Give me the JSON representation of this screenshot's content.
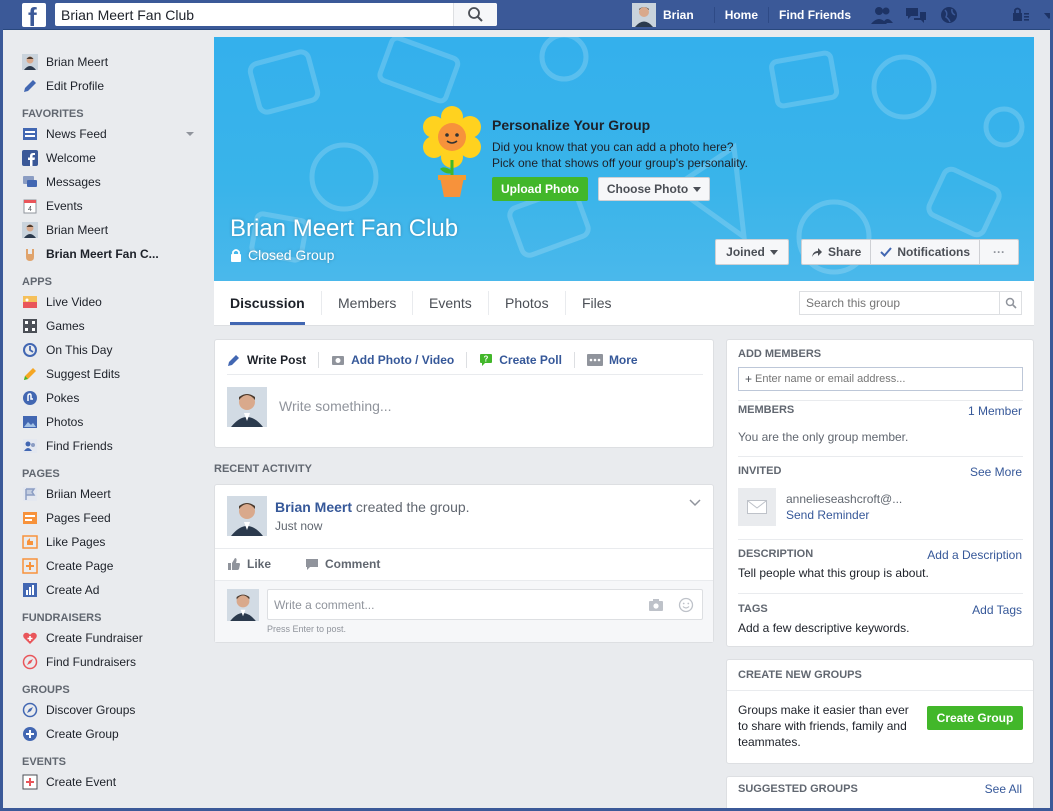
{
  "topbar": {
    "logo": "f",
    "search_value": "Brian Meert Fan Club",
    "user_name": "Brian",
    "links": [
      "Home",
      "Find Friends"
    ],
    "icons": [
      "friend-requests-icon",
      "messages-icon",
      "notifications-globe-icon",
      "privacy-lock-icon",
      "account-menu-icon"
    ]
  },
  "sidebar": {
    "profile": [
      {
        "label": "Brian Meert",
        "icon": "avatar"
      },
      {
        "label": "Edit Profile",
        "icon": "pencil-icon"
      }
    ],
    "sections": [
      {
        "heading": "FAVORITES",
        "items": [
          {
            "label": "News Feed",
            "icon": "news-feed-icon"
          },
          {
            "label": "Welcome",
            "icon": "facebook-icon"
          },
          {
            "label": "Messages",
            "icon": "messages-icon"
          },
          {
            "label": "Events",
            "icon": "calendar-icon"
          },
          {
            "label": "Brian Meert",
            "icon": "avatar"
          },
          {
            "label": "Brian Meert Fan C...",
            "icon": "rock-hand-icon"
          }
        ]
      },
      {
        "heading": "APPS",
        "items": [
          {
            "label": "Live Video",
            "icon": "live-video-icon"
          },
          {
            "label": "Games",
            "icon": "games-icon"
          },
          {
            "label": "On This Day",
            "icon": "clock-icon"
          },
          {
            "label": "Suggest Edits",
            "icon": "suggest-edits-icon"
          },
          {
            "label": "Pokes",
            "icon": "poke-icon"
          },
          {
            "label": "Photos",
            "icon": "photos-icon"
          },
          {
            "label": "Find Friends",
            "icon": "find-friends-icon"
          }
        ]
      },
      {
        "heading": "PAGES",
        "items": [
          {
            "label": "Briian Meert",
            "icon": "flag-icon"
          },
          {
            "label": "Pages Feed",
            "icon": "pages-feed-icon"
          },
          {
            "label": "Like Pages",
            "icon": "like-pages-icon"
          },
          {
            "label": "Create Page",
            "icon": "create-page-icon"
          },
          {
            "label": "Create Ad",
            "icon": "create-ad-icon"
          }
        ]
      },
      {
        "heading": "FUNDRAISERS",
        "items": [
          {
            "label": "Create Fundraiser",
            "icon": "heart-plus-icon"
          },
          {
            "label": "Find Fundraisers",
            "icon": "compass-icon"
          }
        ]
      },
      {
        "heading": "GROUPS",
        "items": [
          {
            "label": "Discover Groups",
            "icon": "compass-blue-icon"
          },
          {
            "label": "Create Group",
            "icon": "plus-circle-icon"
          }
        ]
      },
      {
        "heading": "EVENTS",
        "items": [
          {
            "label": "Create Event",
            "icon": "create-event-icon"
          }
        ]
      }
    ]
  },
  "cover": {
    "promo_title": "Personalize Your Group",
    "promo_line1": "Did you know that you can add a photo here?",
    "promo_line2": "Pick one that shows off your group's personality.",
    "upload_label": "Upload Photo",
    "choose_label": "Choose Photo",
    "group_name": "Brian Meert Fan Club",
    "privacy": "Closed Group",
    "joined_label": "Joined",
    "share_label": "Share",
    "notifications_label": "Notifications",
    "more_label": "···"
  },
  "tabs": {
    "items": [
      "Discussion",
      "Members",
      "Events",
      "Photos",
      "Files"
    ],
    "active": "Discussion",
    "search_placeholder": "Search this group"
  },
  "composer": {
    "tabs": [
      "Write Post",
      "Add Photo / Video",
      "Create Poll",
      "More"
    ],
    "placeholder": "Write something..."
  },
  "activity": {
    "heading": "RECENT ACTIVITY",
    "author": "Brian Meert",
    "action": "created the group.",
    "time": "Just now",
    "like_label": "Like",
    "comment_label": "Comment",
    "comment_placeholder": "Write a comment...",
    "comment_hint": "Press Enter to post."
  },
  "right": {
    "add_members_heading": "ADD MEMBERS",
    "add_members_placeholder": "Enter name or email address...",
    "members_heading": "MEMBERS",
    "members_count": "1 Member",
    "members_text": "You are the only group member.",
    "invited_heading": "INVITED",
    "invited_see_more": "See More",
    "invited_email": "annelieseashcroft@...",
    "send_reminder": "Send Reminder",
    "description_heading": "DESCRIPTION",
    "add_description": "Add a Description",
    "description_text": "Tell people what this group is about.",
    "tags_heading": "TAGS",
    "add_tags": "Add Tags",
    "tags_text": "Add a few descriptive keywords.",
    "create_groups_heading": "CREATE NEW GROUPS",
    "create_groups_text": "Groups make it easier than ever to share with friends, family and teammates.",
    "create_group_button": "Create Group",
    "suggested_heading": "SUGGESTED GROUPS",
    "suggested_see_all": "See All"
  },
  "colors": {
    "brand": "#3b5998",
    "link": "#365899",
    "green": "#42b72a",
    "cover": "#39b4ea"
  }
}
